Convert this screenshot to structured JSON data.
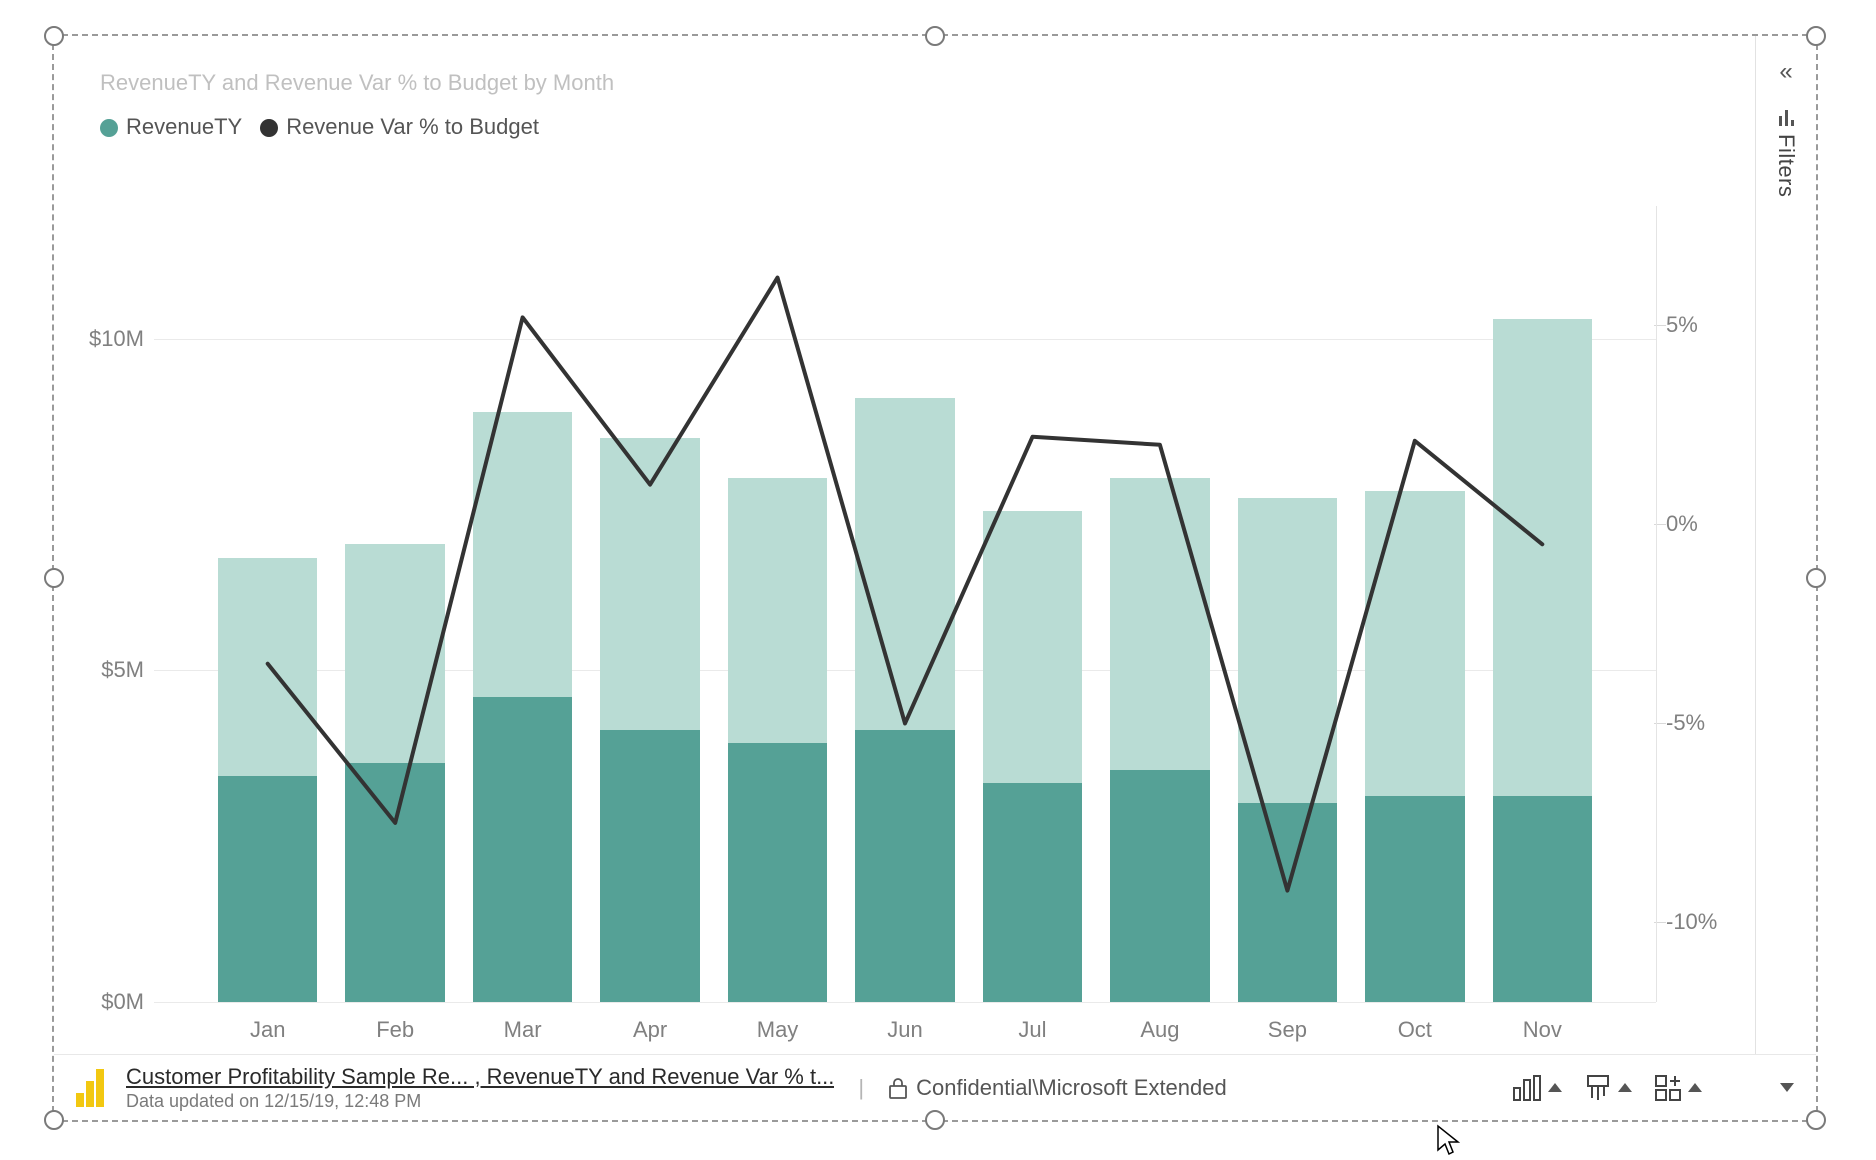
{
  "chart_data": {
    "type": "bar+line",
    "title": "RevenueTY and Revenue Var % to Budget by Month",
    "categories": [
      "Jan",
      "Feb",
      "Mar",
      "Apr",
      "May",
      "Jun",
      "Jul",
      "Aug",
      "Sep",
      "Oct",
      "Nov"
    ],
    "series": [
      {
        "name": "RevenueTY_total",
        "values": [
          6.7,
          6.9,
          8.9,
          8.5,
          7.9,
          9.1,
          7.4,
          7.9,
          7.6,
          7.7,
          10.3
        ],
        "unit": "$M",
        "visual": "bar-light",
        "color": "#b9dcd4"
      },
      {
        "name": "RevenueTY_highlight",
        "values": [
          3.4,
          3.6,
          4.6,
          4.1,
          3.9,
          4.1,
          3.3,
          3.5,
          3.0,
          3.1,
          3.1
        ],
        "unit": "$M",
        "visual": "bar-dark",
        "color": "#55a196"
      },
      {
        "name": "Revenue Var % to Budget",
        "values": [
          -3.5,
          -7.5,
          5.2,
          1.0,
          6.2,
          -5.0,
          2.2,
          2.0,
          -9.2,
          2.1,
          -0.5
        ],
        "unit": "%",
        "visual": "line",
        "color": "#333333"
      }
    ],
    "y_left": {
      "label": "",
      "ticks": [
        0,
        5,
        10
      ],
      "tick_labels": [
        "$0M",
        "$5M",
        "$10M"
      ],
      "min": 0,
      "max": 12
    },
    "y_right": {
      "label": "",
      "ticks": [
        -10,
        -5,
        0,
        5
      ],
      "tick_labels": [
        "-10%",
        "-5%",
        "0%",
        "5%"
      ],
      "min": -12,
      "max": 8
    }
  },
  "legend": {
    "items": [
      {
        "label": "RevenueTY",
        "color": "#55a196"
      },
      {
        "label": "Revenue Var % to Budget",
        "color": "#333333"
      }
    ]
  },
  "filters": {
    "pane_label": "Filters"
  },
  "status": {
    "breadcrumb_line1": "Customer Profitability Sample Re... , RevenueTY and Revenue Var % t...",
    "breadcrumb_line2": "Data updated on 12/15/19, 12:48 PM",
    "sensitivity_label": "Confidential\\Microsoft Extended"
  }
}
